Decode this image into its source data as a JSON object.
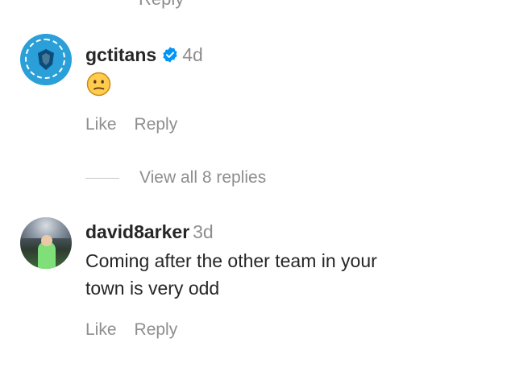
{
  "top_cut_text": "Reply",
  "comments": [
    {
      "username": "gctitans",
      "verified": true,
      "time": "4d",
      "emoji": "confused-face",
      "like_label": "Like",
      "reply_label": "Reply",
      "view_replies_label": "View all 8 replies"
    },
    {
      "username": "david8arker",
      "verified": false,
      "time": "3d",
      "text_line1": "Coming after the other team in your",
      "text_line2": "town is very odd",
      "like_label": "Like",
      "reply_label": "Reply"
    }
  ],
  "colors": {
    "text": "#262626",
    "secondary": "#8e8e8e",
    "verified": "#0095f6",
    "divider": "#c7c7c7"
  }
}
